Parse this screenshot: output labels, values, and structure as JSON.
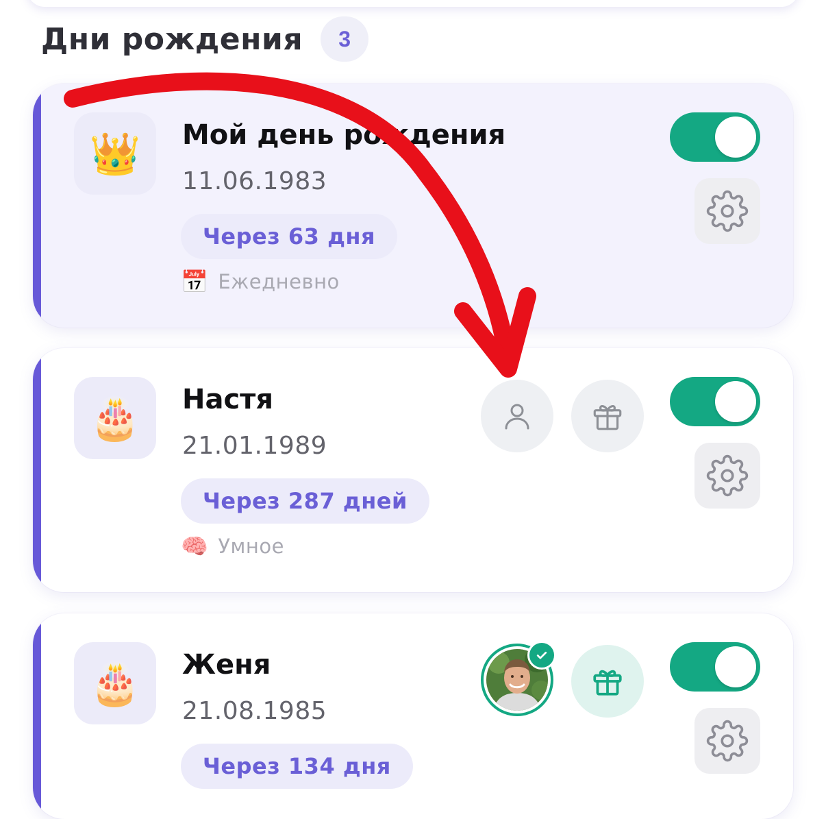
{
  "section": {
    "title": "Дни рождения",
    "count": "3"
  },
  "cards": [
    {
      "name": "Мой день рождения",
      "date": "11.06.1983",
      "days_label": "Через 63 дня",
      "mode_label": "Ежедневно",
      "mode_icon": "calendar-icon",
      "avatar_icon": "crown-icon",
      "enabled": true
    },
    {
      "name": "Настя",
      "date": "21.01.1989",
      "days_label": "Через 287 дней",
      "mode_label": "Умное",
      "mode_icon": "brain-icon",
      "avatar_icon": "cake-icon",
      "enabled": true
    },
    {
      "name": "Женя",
      "date": "21.08.1985",
      "days_label": "Через 134 дня",
      "avatar_icon": "cake-icon",
      "enabled": true
    }
  ],
  "colors": {
    "accent": "#6759d8",
    "toggle_on": "#14a883",
    "arrow": "#e8101a"
  }
}
